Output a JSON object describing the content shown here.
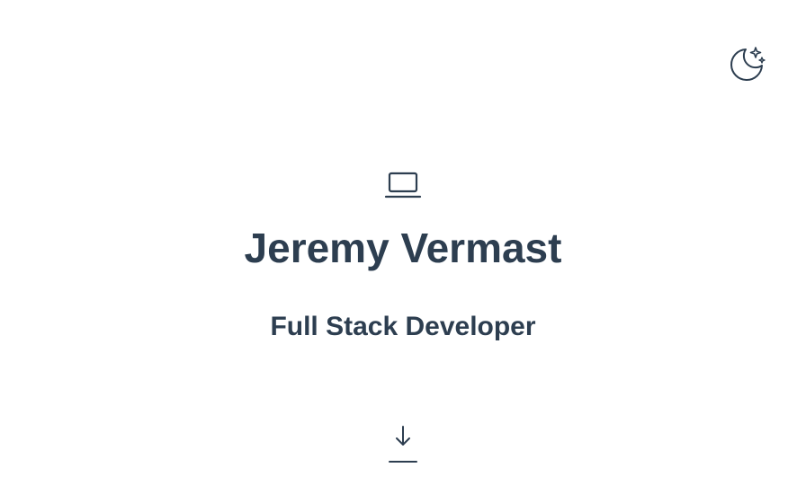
{
  "header": {
    "theme_toggle_icon": "moon-stars-icon"
  },
  "hero": {
    "icon": "laptop-icon",
    "name": "Jeremy Vermast",
    "role": "Full Stack Developer",
    "scroll_icon": "arrow-down-to-line-icon"
  },
  "colors": {
    "text": "#2d3e50",
    "background": "#ffffff"
  }
}
